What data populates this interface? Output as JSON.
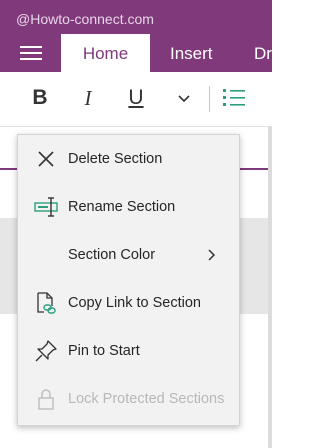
{
  "watermark": "@Howto-connect.com",
  "tabs": [
    {
      "label": "Home",
      "active": true
    },
    {
      "label": "Insert",
      "active": false
    },
    {
      "label": "Dr",
      "active": false
    }
  ],
  "toolbar": {
    "bold": "B",
    "italic": "I",
    "underline": "U"
  },
  "menu": {
    "items": [
      {
        "label": "Delete Section",
        "icon": "close-icon",
        "enabled": true
      },
      {
        "label": "Rename Section",
        "icon": "rename-icon",
        "enabled": true
      },
      {
        "label": "Section Color",
        "icon": "",
        "enabled": true,
        "submenu": true
      },
      {
        "label": "Copy Link to Section",
        "icon": "link-icon",
        "enabled": true
      },
      {
        "label": "Pin to Start",
        "icon": "pin-icon",
        "enabled": true
      },
      {
        "label": "Lock Protected Sections",
        "icon": "lock-icon",
        "enabled": false
      }
    ]
  },
  "colors": {
    "brand": "#80397b",
    "menu_bg": "#f2f2f2",
    "disabled_text": "#b8b8b8"
  }
}
